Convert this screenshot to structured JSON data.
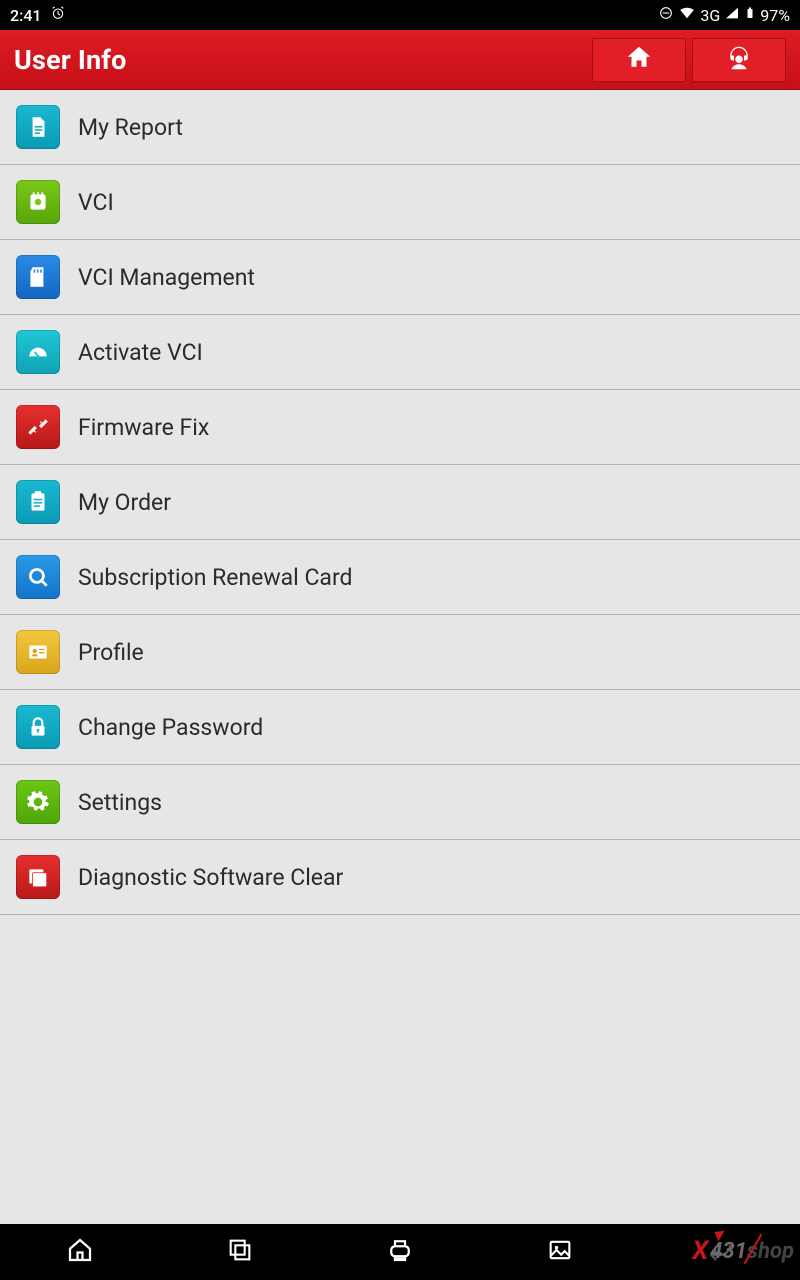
{
  "status": {
    "time": "2:41",
    "network": "3G",
    "battery": "97%"
  },
  "header": {
    "title": "User Info"
  },
  "menu": [
    {
      "id": "my-report",
      "label": "My Report",
      "icon": "document-icon",
      "color": "teal"
    },
    {
      "id": "vci",
      "label": "VCI",
      "icon": "chip-icon",
      "color": "green"
    },
    {
      "id": "vci-mgmt",
      "label": "VCI Management",
      "icon": "sd-card-icon",
      "color": "blue"
    },
    {
      "id": "activate-vci",
      "label": "Activate VCI",
      "icon": "gauge-icon",
      "color": "teal2"
    },
    {
      "id": "firmware-fix",
      "label": "Firmware Fix",
      "icon": "tools-icon",
      "color": "red"
    },
    {
      "id": "my-order",
      "label": "My Order",
      "icon": "clipboard-icon",
      "color": "teal"
    },
    {
      "id": "sub-card",
      "label": "Subscription Renewal Card",
      "icon": "search-icon",
      "color": "blue2"
    },
    {
      "id": "profile",
      "label": "Profile",
      "icon": "id-card-icon",
      "color": "yellow"
    },
    {
      "id": "change-pw",
      "label": "Change Password",
      "icon": "lock-icon",
      "color": "teal"
    },
    {
      "id": "settings",
      "label": "Settings",
      "icon": "gear-icon",
      "color": "green2"
    },
    {
      "id": "diag-clear",
      "label": "Diagnostic Software Clear",
      "icon": "windows-icon",
      "color": "red"
    }
  ],
  "watermark": {
    "prefix": "X",
    "mid": "431",
    "suffix": "shop"
  }
}
